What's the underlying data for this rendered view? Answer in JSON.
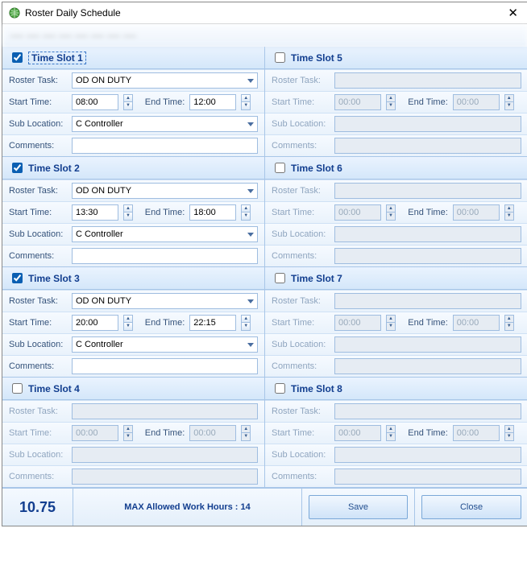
{
  "window": {
    "title": "Roster Daily Schedule"
  },
  "labels": {
    "roster_task": "Roster Task:",
    "start_time": "Start Time:",
    "end_time": "End Time:",
    "sub_location": "Sub Location:",
    "comments": "Comments:"
  },
  "timePlaceholder": "00:00",
  "slots": [
    {
      "enabled": true,
      "title": "Time Slot 1",
      "selected": true,
      "roster_task": "OD ON DUTY",
      "start": "08:00",
      "end": "12:00",
      "sub_location": "C Controller",
      "comments": ""
    },
    {
      "enabled": true,
      "title": "Time Slot 2",
      "selected": false,
      "roster_task": "OD ON DUTY",
      "start": "13:30",
      "end": "18:00",
      "sub_location": "C Controller",
      "comments": ""
    },
    {
      "enabled": true,
      "title": "Time Slot 3",
      "selected": false,
      "roster_task": "OD ON DUTY",
      "start": "20:00",
      "end": "22:15",
      "sub_location": "C Controller",
      "comments": ""
    },
    {
      "enabled": false,
      "title": "Time Slot 4",
      "selected": false,
      "roster_task": "",
      "start": "00:00",
      "end": "00:00",
      "sub_location": "",
      "comments": ""
    },
    {
      "enabled": false,
      "title": "Time Slot 5",
      "selected": false,
      "roster_task": "",
      "start": "00:00",
      "end": "00:00",
      "sub_location": "",
      "comments": ""
    },
    {
      "enabled": false,
      "title": "Time Slot 6",
      "selected": false,
      "roster_task": "",
      "start": "00:00",
      "end": "00:00",
      "sub_location": "",
      "comments": ""
    },
    {
      "enabled": false,
      "title": "Time Slot 7",
      "selected": false,
      "roster_task": "",
      "start": "00:00",
      "end": "00:00",
      "sub_location": "",
      "comments": ""
    },
    {
      "enabled": false,
      "title": "Time Slot 8",
      "selected": false,
      "roster_task": "",
      "start": "00:00",
      "end": "00:00",
      "sub_location": "",
      "comments": ""
    }
  ],
  "footer": {
    "total_hours": "10.75",
    "max_label": "MAX Allowed Work Hours : 14",
    "save": "Save",
    "close": "Close"
  }
}
